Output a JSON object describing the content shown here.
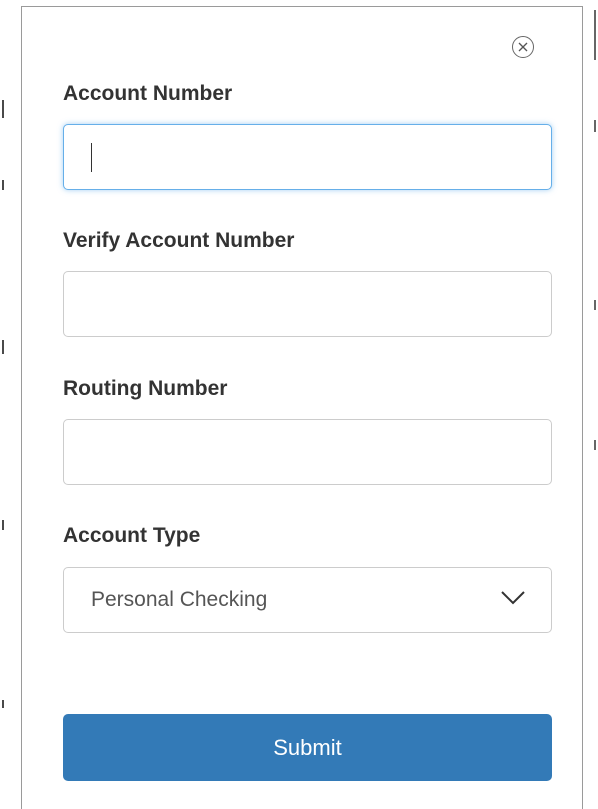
{
  "form": {
    "account_number": {
      "label": "Account Number",
      "value": ""
    },
    "verify_account_number": {
      "label": "Verify Account Number",
      "value": ""
    },
    "routing_number": {
      "label": "Routing Number",
      "value": ""
    },
    "account_type": {
      "label": "Account Type",
      "selected": "Personal Checking"
    },
    "submit_label": "Submit"
  },
  "icons": {
    "close": "close-circle-icon",
    "dropdown": "chevron-down-icon"
  },
  "colors": {
    "submit_bg": "#337ab7",
    "focus_border": "#66afe9",
    "label_text": "#333333"
  }
}
